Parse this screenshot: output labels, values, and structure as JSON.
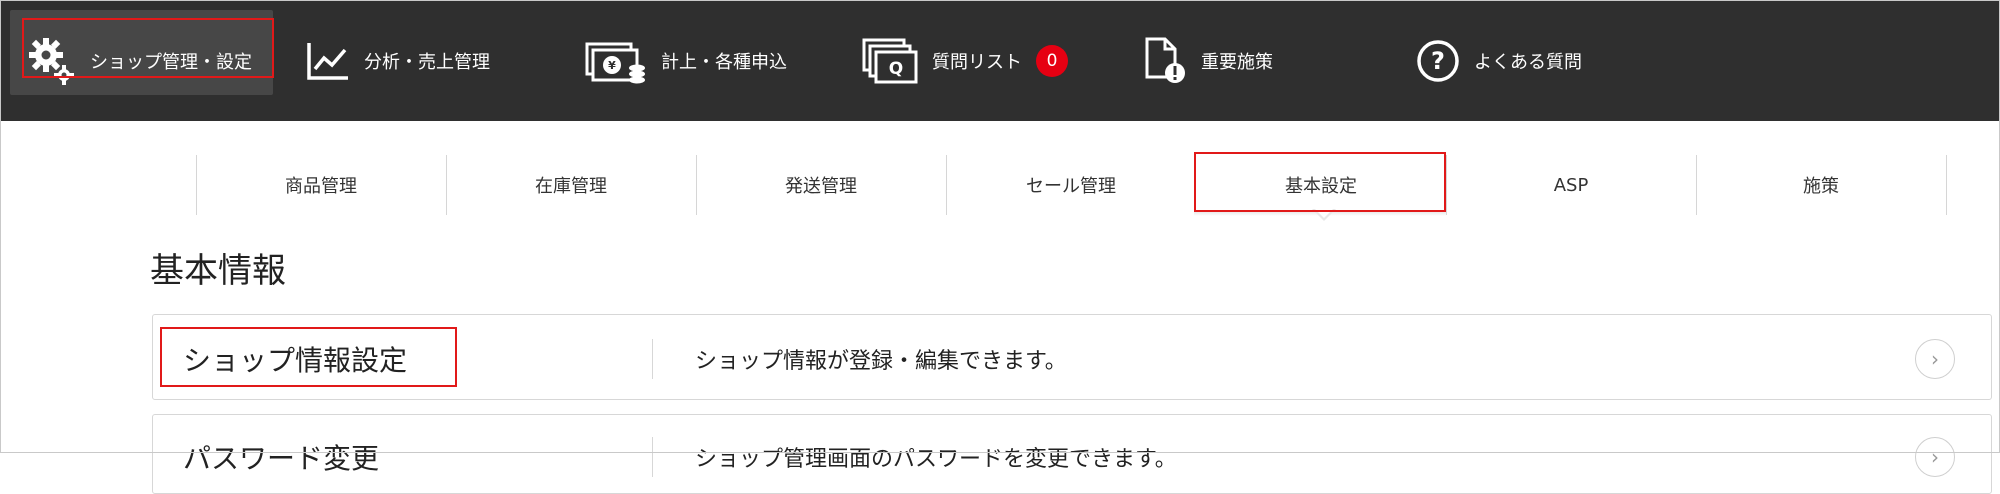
{
  "topnav": {
    "items": [
      {
        "label": "ショップ管理・設定",
        "icon": "gears-icon"
      },
      {
        "label": "分析・売上管理",
        "icon": "line-chart-icon"
      },
      {
        "label": "計上・各種申込",
        "icon": "money-coins-icon"
      },
      {
        "label": "質問リスト",
        "icon": "question-list-icon",
        "badge": "0"
      },
      {
        "label": "重要施策",
        "icon": "important-document-icon"
      },
      {
        "label": "よくある質問",
        "icon": "help-circle-icon"
      }
    ]
  },
  "subnav": {
    "tabs": [
      {
        "label": "商品管理"
      },
      {
        "label": "在庫管理"
      },
      {
        "label": "発送管理"
      },
      {
        "label": "セール管理"
      },
      {
        "label": "基本設定",
        "active": true
      },
      {
        "label": "ASP"
      },
      {
        "label": "施策"
      }
    ]
  },
  "section": {
    "title": "基本情報"
  },
  "rows": [
    {
      "title": "ショップ情報設定",
      "description": "ショップ情報が登録・編集できます。"
    },
    {
      "title": "パスワード変更",
      "description": "ショップ管理画面のパスワードを変更できます。"
    }
  ],
  "colors": {
    "topbar": "#2f2f2f",
    "highlight": "#e11919",
    "badge": "#e60012"
  }
}
